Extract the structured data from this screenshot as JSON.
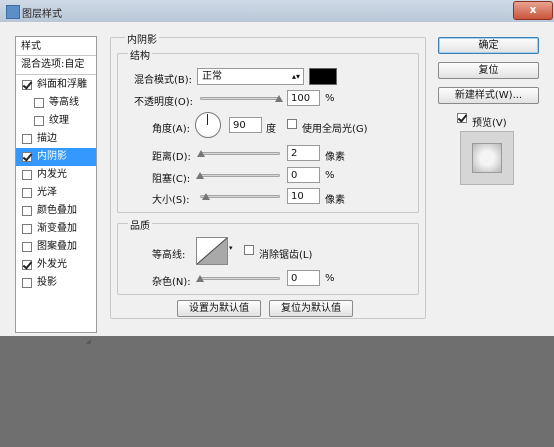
{
  "window": {
    "title": "图层样式",
    "close_label": "x"
  },
  "sidebar": {
    "header": "样式",
    "blend_options": "混合选项:自定",
    "items": [
      {
        "label": "斜面和浮雕",
        "checked": true
      },
      {
        "label": "等高线",
        "checked": false
      },
      {
        "label": "纹理",
        "checked": false
      },
      {
        "label": "描边",
        "checked": false
      },
      {
        "label": "内阴影",
        "checked": true,
        "selected": true
      },
      {
        "label": "内发光",
        "checked": false
      },
      {
        "label": "光泽",
        "checked": false
      },
      {
        "label": "颜色叠加",
        "checked": false
      },
      {
        "label": "渐变叠加",
        "checked": false
      },
      {
        "label": "图案叠加",
        "checked": false
      },
      {
        "label": "外发光",
        "checked": true
      },
      {
        "label": "投影",
        "checked": false
      }
    ]
  },
  "inner_shadow": {
    "group_title": "内阴影",
    "structure": {
      "title": "结构",
      "blend_mode_label": "混合模式(B):",
      "blend_mode_value": "正常",
      "shadow_color": "#000000",
      "opacity_label": "不透明度(O):",
      "opacity_value": "100",
      "opacity_unit": "%",
      "angle_label": "角度(A):",
      "angle_value": "90",
      "angle_unit": "度",
      "global_light_label": "使用全局光(G)",
      "global_light_checked": false,
      "distance_label": "距离(D):",
      "distance_value": "2",
      "distance_unit": "像素",
      "choke_label": "阻塞(C):",
      "choke_value": "0",
      "choke_unit": "%",
      "size_label": "大小(S):",
      "size_value": "10",
      "size_unit": "像素"
    },
    "quality": {
      "title": "品质",
      "contour_label": "等高线:",
      "anti_alias_label": "消除锯齿(L)",
      "anti_alias_checked": false,
      "noise_label": "杂色(N):",
      "noise_value": "0",
      "noise_unit": "%"
    },
    "set_default_label": "设置为默认值",
    "reset_default_label": "复位为默认值"
  },
  "actions": {
    "ok_label": "确定",
    "reset_label": "复位",
    "new_style_label": "新建样式(W)...",
    "preview_label": "预览(V)",
    "preview_checked": true
  }
}
